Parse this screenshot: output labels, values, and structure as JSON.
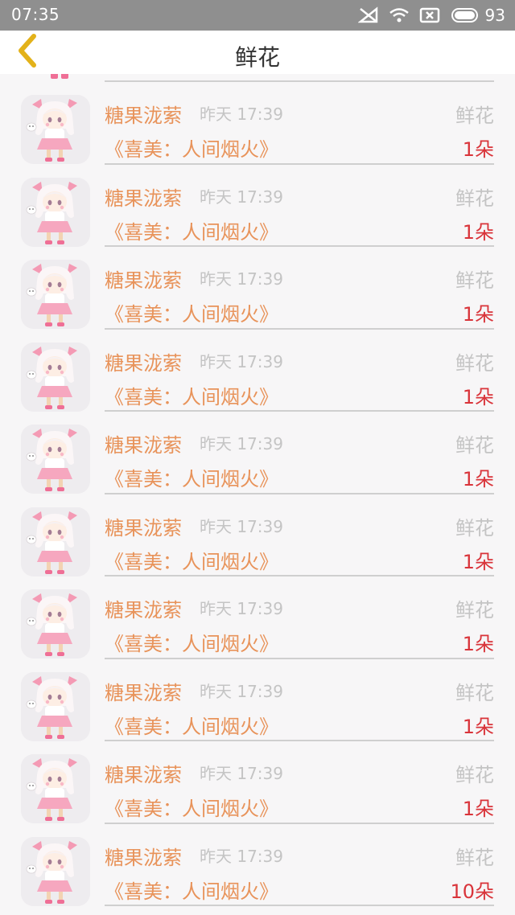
{
  "status_bar": {
    "time": "07:35",
    "battery_level": "93",
    "icons": [
      "signal-off-icon",
      "wifi-icon",
      "sim-disabled-icon",
      "battery-icon"
    ]
  },
  "header": {
    "title": "鲜花",
    "back_icon": "chevron-left-icon"
  },
  "colors": {
    "accent_orange": "#e8935a",
    "count_red": "#d9343a",
    "muted_gray": "#c4c4c4",
    "back_yellow": "#e3b21a"
  },
  "records": [
    {
      "sender": "糖果泷萦",
      "time": "昨天 17:39",
      "type": "鲜花",
      "work": "《喜美：人间烟火》",
      "count": "1朵"
    },
    {
      "sender": "糖果泷萦",
      "time": "昨天 17:39",
      "type": "鲜花",
      "work": "《喜美：人间烟火》",
      "count": "1朵"
    },
    {
      "sender": "糖果泷萦",
      "time": "昨天 17:39",
      "type": "鲜花",
      "work": "《喜美：人间烟火》",
      "count": "1朵"
    },
    {
      "sender": "糖果泷萦",
      "time": "昨天 17:39",
      "type": "鲜花",
      "work": "《喜美：人间烟火》",
      "count": "1朵"
    },
    {
      "sender": "糖果泷萦",
      "time": "昨天 17:39",
      "type": "鲜花",
      "work": "《喜美：人间烟火》",
      "count": "1朵"
    },
    {
      "sender": "糖果泷萦",
      "time": "昨天 17:39",
      "type": "鲜花",
      "work": "《喜美：人间烟火》",
      "count": "1朵"
    },
    {
      "sender": "糖果泷萦",
      "time": "昨天 17:39",
      "type": "鲜花",
      "work": "《喜美：人间烟火》",
      "count": "1朵"
    },
    {
      "sender": "糖果泷萦",
      "time": "昨天 17:39",
      "type": "鲜花",
      "work": "《喜美：人间烟火》",
      "count": "1朵"
    },
    {
      "sender": "糖果泷萦",
      "time": "昨天 17:39",
      "type": "鲜花",
      "work": "《喜美：人间烟火》",
      "count": "1朵"
    },
    {
      "sender": "糖果泷萦",
      "time": "昨天 17:39",
      "type": "鲜花",
      "work": "《喜美：人间烟火》",
      "count": "10朵"
    }
  ]
}
